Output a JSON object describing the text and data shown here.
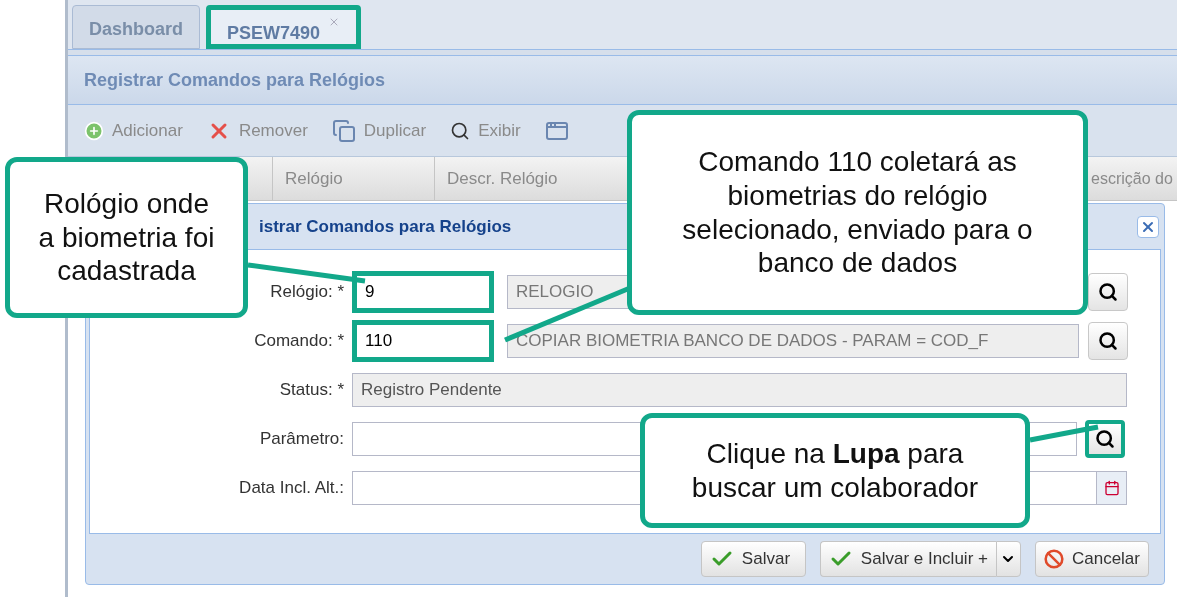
{
  "tabs": [
    {
      "label": "Dashboard",
      "selected": false,
      "closable": false,
      "highlighted": false
    },
    {
      "label": "PSEW7490",
      "selected": true,
      "closable": true,
      "highlighted": true
    }
  ],
  "panel": {
    "title": "Registrar Comandos para Relógios"
  },
  "toolbar": [
    {
      "kind": "add",
      "label": "Adicionar"
    },
    {
      "kind": "remove",
      "label": "Remover"
    },
    {
      "kind": "duplicate",
      "label": "Duplicar"
    },
    {
      "kind": "view",
      "label": "Exibir"
    },
    {
      "kind": "window"
    }
  ],
  "grid": {
    "columns": [
      "Relógio",
      "Descr. Relógio",
      "escrição do"
    ]
  },
  "dialog": {
    "title": "istrar Comandos para Relógios",
    "fields": [
      {
        "kind": "lookup",
        "label": "Relógio: *",
        "value": "9",
        "description": "RELOGIO",
        "code_highlighted": true,
        "button_highlighted": false
      },
      {
        "kind": "lookup",
        "label": "Comando: *",
        "value": "110",
        "description": "COPIAR BIOMETRIA BANCO DE DADOS - PARAM = COD_F",
        "code_highlighted": true,
        "button_highlighted": false
      },
      {
        "kind": "readonly",
        "label": "Status: *",
        "value": "Registro Pendente"
      },
      {
        "kind": "search",
        "label": "Parâmetro:",
        "button_highlighted": true
      },
      {
        "kind": "date",
        "label": "Data Incl. Alt.:"
      }
    ],
    "buttons": [
      {
        "kind": "save",
        "label": "Salvar"
      },
      {
        "kind": "split",
        "label": "Salvar e Incluir +"
      },
      {
        "kind": "cancel",
        "label": "Cancelar"
      }
    ]
  },
  "callouts": [
    {
      "lines": [
        "Rológio onde",
        "a biometria foi",
        "cadastrada"
      ]
    },
    {
      "lines": [
        "Comando 110 coletará as",
        "biometrias do relógio",
        "selecionado, enviado para o",
        "banco de dados"
      ]
    },
    {
      "lines": [
        "Clique na **Lupa** para",
        "buscar um colaborador"
      ]
    }
  ]
}
